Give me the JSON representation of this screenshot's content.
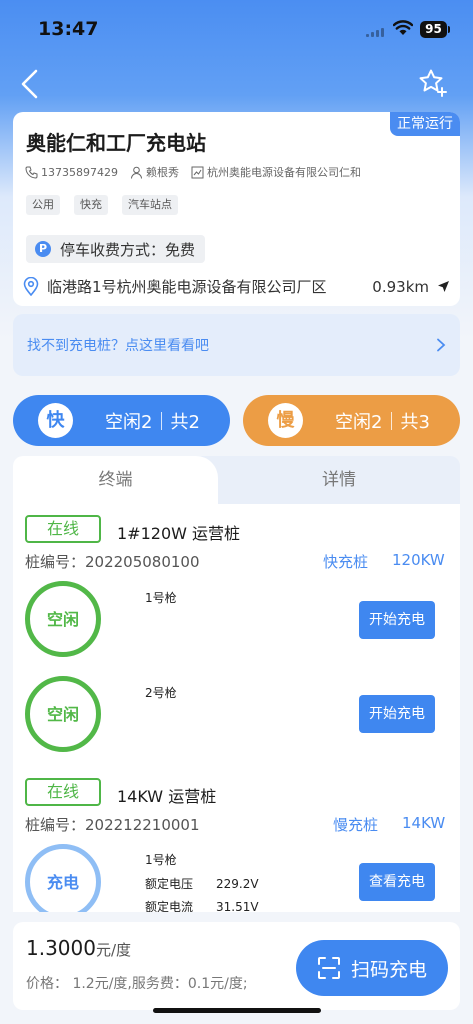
{
  "status_bar": {
    "time": "13:47",
    "battery": "95"
  },
  "nav": {
    "back_icon": "chevron-left-icon",
    "favorite_icon": "star-plus-icon"
  },
  "station": {
    "name": "奥能仁和工厂充电站",
    "status": "正常运行",
    "phone": "13735897429",
    "contact": "赖根秀",
    "company": "杭州奥能电源设备有限公司仁和",
    "tags": [
      "公用",
      "快充",
      "汽车站点"
    ],
    "parking": "停车收费方式：免费",
    "address": "临港路1号杭州奥能电源设备有限公司厂区",
    "distance": "0.93km"
  },
  "hint": {
    "text": "找不到充电桩？点这里看看吧"
  },
  "summary": {
    "fast": {
      "label": "快",
      "status": "空闲2｜共2"
    },
    "slow": {
      "label": "慢",
      "status": "空闲2｜共3"
    }
  },
  "tabs": [
    {
      "label": "终端",
      "active": true
    },
    {
      "label": "详情",
      "active": false
    }
  ],
  "piles": [
    {
      "status": "在线",
      "name": "1#120W 运营桩",
      "number": "桩编号：202205080100",
      "type": "快充桩",
      "power": "120KW",
      "guns": [
        {
          "name": "1号枪",
          "state": "空闲",
          "action": "开始充电"
        },
        {
          "name": "2号枪",
          "state": "空闲",
          "action": "开始充电"
        }
      ]
    },
    {
      "status": "在线",
      "name": "14KW 运营桩",
      "number": "桩编号：202212210001",
      "type": "慢充桩",
      "power": "14KW",
      "guns": [
        {
          "name": "1号枪",
          "state": "充电",
          "action": "查看充电",
          "rated_voltage_label": "额定电压",
          "rated_voltage": "229.2V",
          "rated_current_label": "额定电流",
          "rated_current": "31.51V"
        }
      ]
    }
  ],
  "footer": {
    "price": "1.3000",
    "unit": "元/度",
    "detail": "价格： 1.2元/度,服务费：0.1元/度;",
    "scan_button": "扫码充电"
  },
  "colors": {
    "primary": "#3f87f0",
    "orange": "#ec9d45",
    "green": "#52b848"
  }
}
